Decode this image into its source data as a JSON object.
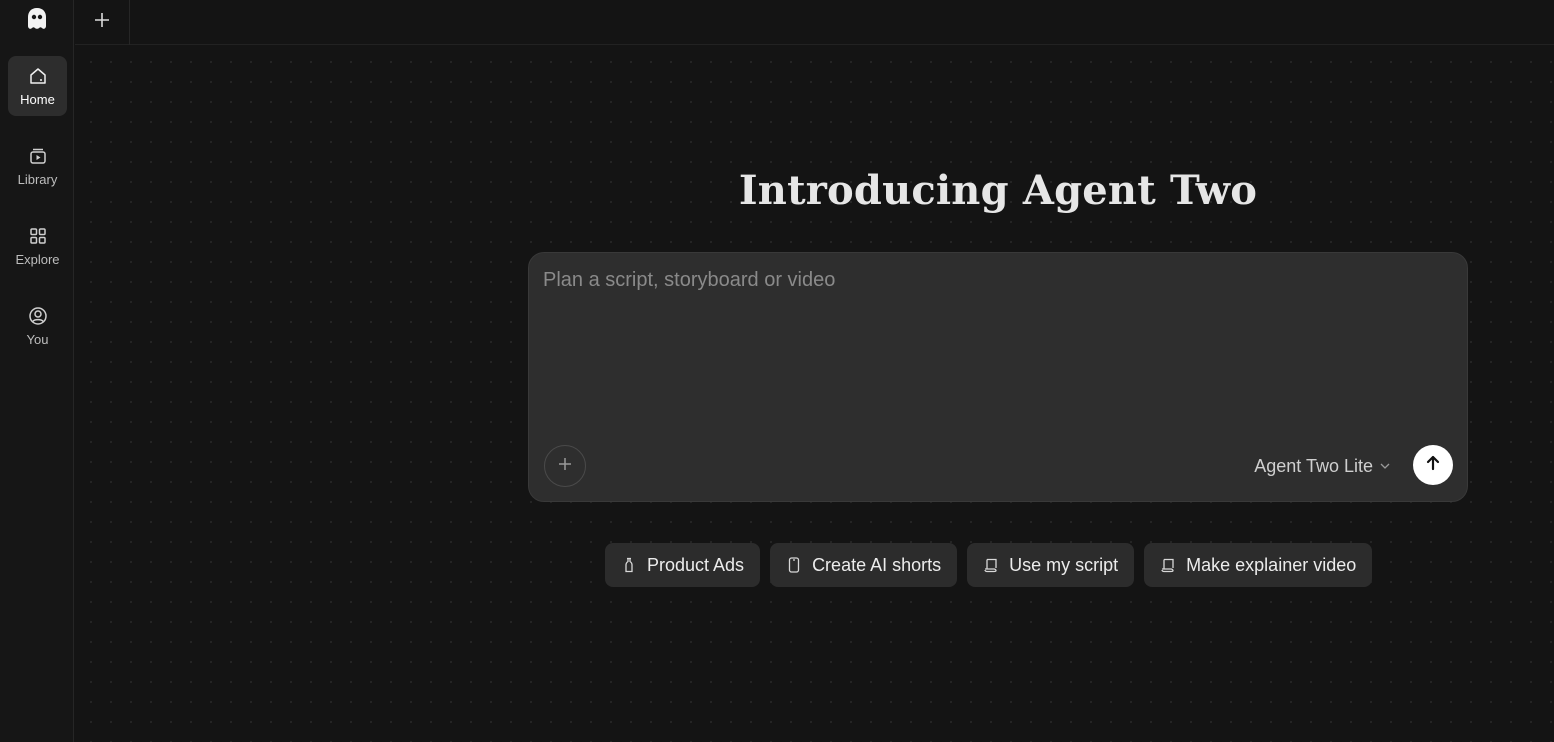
{
  "sidebar": {
    "logo_icon": "ghost-logo-icon",
    "items": [
      {
        "label": "Home",
        "icon": "home-icon",
        "active": true
      },
      {
        "label": "Library",
        "icon": "library-icon",
        "active": false
      },
      {
        "label": "Explore",
        "icon": "grid-icon",
        "active": false
      },
      {
        "label": "You",
        "icon": "user-circle-icon",
        "active": false
      }
    ]
  },
  "topbar": {
    "new_tab_icon": "plus-icon"
  },
  "main": {
    "title": "Introducing Agent Two",
    "composer": {
      "placeholder": "Plan a script, storyboard or video",
      "value": "",
      "attach_icon": "plus-icon",
      "model_label": "Agent Two Lite",
      "model_icon": "chevron-down-icon",
      "send_icon": "arrow-up-icon"
    },
    "chips": [
      {
        "label": "Product Ads",
        "icon": "bottle-icon"
      },
      {
        "label": "Create AI shorts",
        "icon": "phone-icon"
      },
      {
        "label": "Use my script",
        "icon": "script-icon"
      },
      {
        "label": "Make explainer video",
        "icon": "script-icon"
      }
    ]
  },
  "colors": {
    "background": "#141414",
    "sidebar_active": "#2d2d2d",
    "composer_bg": "#2e2e2e",
    "send_button": "#ffffff"
  }
}
